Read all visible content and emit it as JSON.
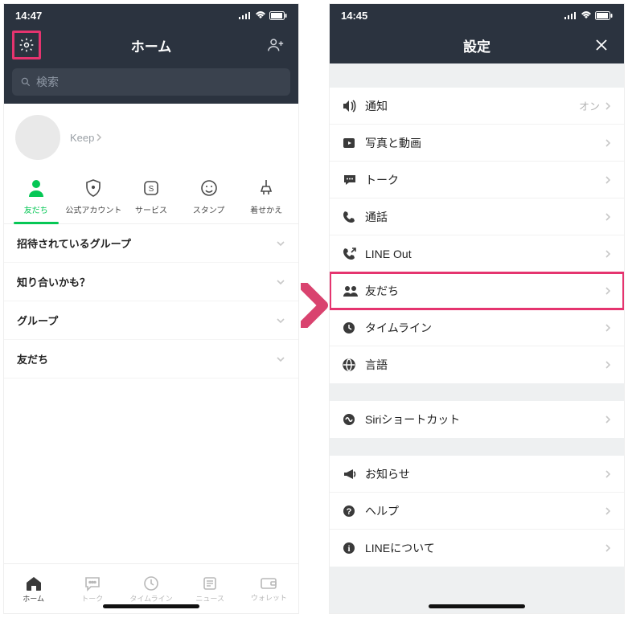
{
  "left": {
    "status_time": "14:47",
    "nav_title": "ホーム",
    "search_placeholder": "検索",
    "keep_label": "Keep",
    "tabs": [
      {
        "label": "友だち"
      },
      {
        "label": "公式アカウント"
      },
      {
        "label": "サービス"
      },
      {
        "label": "スタンプ"
      },
      {
        "label": "着せかえ"
      }
    ],
    "sections": [
      {
        "label": "招待されているグループ"
      },
      {
        "label": "知り合いかも？"
      },
      {
        "label": "グループ"
      },
      {
        "label": "友だち"
      }
    ],
    "bottom": [
      {
        "label": "ホーム"
      },
      {
        "label": "トーク"
      },
      {
        "label": "タイムライン"
      },
      {
        "label": "ニュース"
      },
      {
        "label": "ウォレット"
      }
    ]
  },
  "right": {
    "status_time": "14:45",
    "nav_title": "設定",
    "groups": [
      [
        {
          "icon": "speaker",
          "label": "通知",
          "value": "オン"
        },
        {
          "icon": "video",
          "label": "写真と動画"
        },
        {
          "icon": "chat",
          "label": "トーク"
        },
        {
          "icon": "phone",
          "label": "通話"
        },
        {
          "icon": "phone-out",
          "label": "LINE Out"
        },
        {
          "icon": "friends",
          "label": "友だち",
          "highlight": true
        },
        {
          "icon": "clock",
          "label": "タイムライン"
        },
        {
          "icon": "globe",
          "label": "言語"
        }
      ],
      [
        {
          "icon": "siri",
          "label": "Siriショートカット"
        }
      ],
      [
        {
          "icon": "megaphone",
          "label": "お知らせ"
        },
        {
          "icon": "help",
          "label": "ヘルプ"
        },
        {
          "icon": "info",
          "label": "LINEについて"
        }
      ]
    ]
  }
}
